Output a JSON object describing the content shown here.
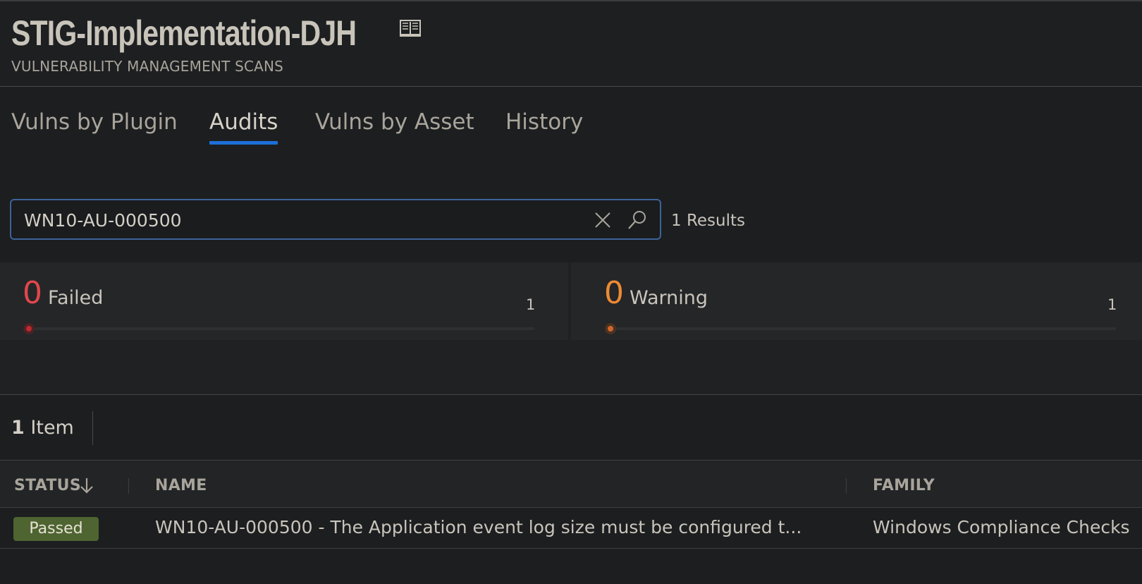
{
  "header": {
    "title": "STIG-Implementation-DJH",
    "subtitle": "VULNERABILITY MANAGEMENT SCANS"
  },
  "tabs": [
    {
      "label": "Vulns by Plugin",
      "active": false
    },
    {
      "label": "Audits",
      "active": true
    },
    {
      "label": "Vulns by Asset",
      "active": false
    },
    {
      "label": "History",
      "active": false
    }
  ],
  "search": {
    "value": "WN10-AU-000500",
    "results": "1 Results"
  },
  "stats": {
    "failed": {
      "count": "0",
      "label": "Failed",
      "max": "1",
      "color": "#e0474c"
    },
    "warning": {
      "count": "0",
      "label": "Warning",
      "max": "1",
      "color": "#ee8a34"
    }
  },
  "items": {
    "count": "1",
    "label": "Item"
  },
  "table": {
    "columns": {
      "status": "STATUS",
      "name": "NAME",
      "family": "FAMILY"
    },
    "rows": [
      {
        "status": "Passed",
        "name": "WN10-AU-000500 - The Application event log size must be configured t...",
        "family": "Windows Compliance Checks"
      }
    ]
  },
  "colors": {
    "accent": "#1e6fd9",
    "passed": "#4e6431",
    "background": "#1c1e20"
  }
}
